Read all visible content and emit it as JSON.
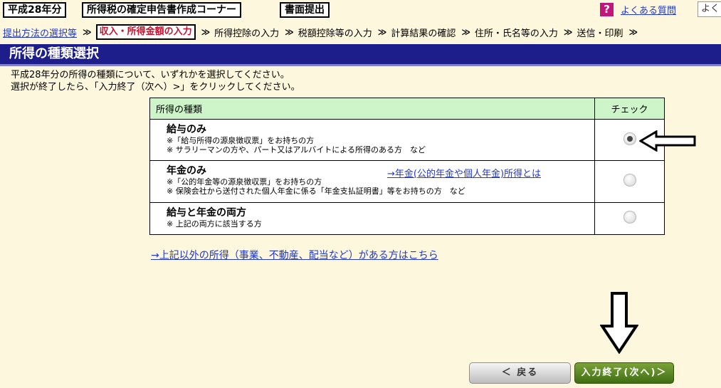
{
  "header": {
    "year_tag": "平成28年分",
    "corner_tag": "所得税の確定申告書作成コーナー",
    "mode_tag": "書面提出",
    "help_glyph": "?",
    "faq_label": "よくある質問",
    "faq_tab": "よく"
  },
  "breadcrumb": {
    "steps": [
      {
        "label": "提出方法の選択等"
      },
      {
        "label": "収入・所得金額の入力"
      },
      {
        "label": "所得控除の入力"
      },
      {
        "label": "税額控除等の入力"
      },
      {
        "label": "計算結果の確認"
      },
      {
        "label": "住所・氏名等の入力"
      },
      {
        "label": "送信・印刷"
      }
    ],
    "separator": "≫"
  },
  "page": {
    "title": "所得の種類選択",
    "instruction_line1": "平成28年分の所得の種類について、いずれかを選択してください。",
    "instruction_line2": "選択が終了したら、「入力終了（次へ）>」をクリックしてください。"
  },
  "table": {
    "col_type": "所得の種類",
    "col_check": "チェック",
    "rows": [
      {
        "title": "給与のみ",
        "note1": "※「給与所得の源泉徴収票」をお持ちの方",
        "note2": "※ サラリーマンの方や、パート又はアルバイトによる所得のある方　など",
        "link": ""
      },
      {
        "title": "年金のみ",
        "note1": "※「公的年金等の源泉徴収票」をお持ちの方",
        "note2": "※ 保険会社から送付された個人年金に係る「年金支払証明書」等をお持ちの方　など",
        "link": "→年金(公的年金や個人年金)所得とは"
      },
      {
        "title": "給与と年金の両方",
        "note1": "※ 上記の両方に該当する方",
        "note2": "",
        "link": ""
      }
    ]
  },
  "selected_row": 0,
  "other_income_link": "→上記以外の所得（事業、不動産、配当など）がある方はこちら",
  "buttons": {
    "back": "＜ 戻る",
    "next": "入力終了(次へ)＞"
  },
  "colors": {
    "title_bar": "#1d1d8c",
    "page_bg": "#fdf7dd",
    "table_header": "#cdf5c9",
    "current_step": "#c8102e",
    "link": "#2339c4",
    "next_button": "#4a7a17"
  }
}
